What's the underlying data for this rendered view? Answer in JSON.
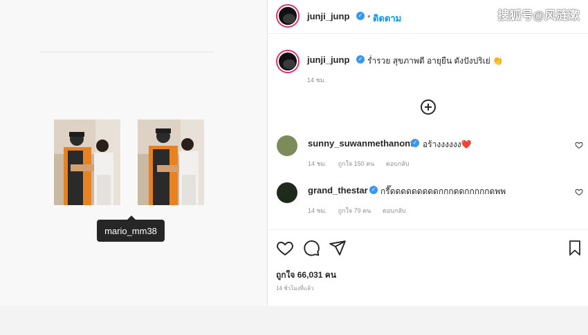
{
  "watermark": "搜狐号@风涟漱",
  "tag_tooltip": "mario_mm38",
  "header": {
    "username": "junji_junp",
    "dot": "•",
    "follow_label": "ติดตาม"
  },
  "caption": {
    "username": "junji_junp",
    "text": "ร่ำรวย สุขภาพดี อายุยืน ดังปังปริเย่ 👏",
    "time": "14 ชม."
  },
  "comments": [
    {
      "username": "sunny_suwanmethanont",
      "text": "อร้างงงงงง❤️",
      "time": "14 ชม.",
      "likes": "ถูกใจ 150 คน",
      "reply": "ตอบกลับ"
    },
    {
      "username": "grand_thestar",
      "text": "กรี๊ดดดดดดดดดกกกดดกกกกกดพพ",
      "time": "14 ชม.",
      "likes": "ถูกใจ 79 คน",
      "reply": "ตอบกลับ"
    }
  ],
  "likes_label": "ถูกใจ 66,031 คน",
  "post_time": "14 ชั่วโมงที่แล้ว",
  "colors": {
    "verified": "#3897f0",
    "follow": "#0095f6",
    "heart_red": "#e0245e",
    "story_ring": "#e1306c"
  },
  "icons": {
    "like": "heart-outline",
    "comment": "speech-bubble",
    "share": "paper-plane",
    "save": "bookmark"
  }
}
